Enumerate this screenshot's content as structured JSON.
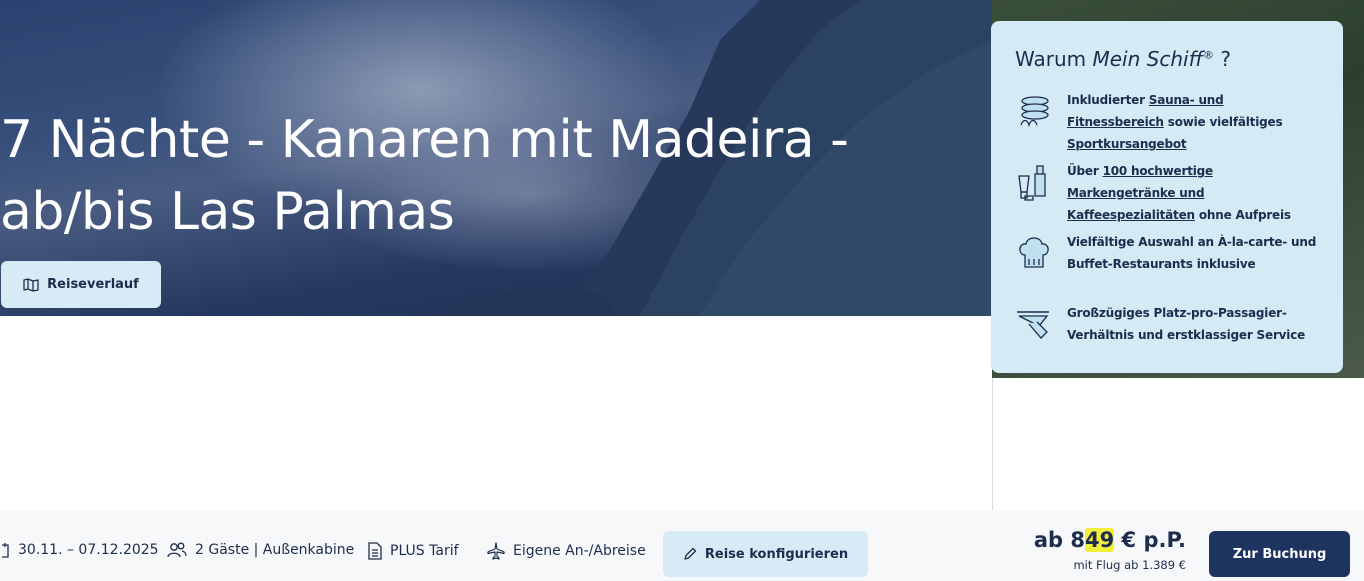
{
  "hero": {
    "title_line1": "7 Nächte - Kanaren mit Madeira -",
    "title_line2": "ab/bis Las Palmas",
    "route_button": "Reiseverlauf"
  },
  "why": {
    "title_prefix": "Warum ",
    "title_brand": "Mein Schiff",
    "title_reg": "®",
    "title_suffix": " ?",
    "features": [
      {
        "icon": "sauna-stones-icon",
        "pre": "Inkludierter ",
        "link1": "Sauna- und Fitnessbereich",
        "mid": " sowie vielfältiges ",
        "link2": "Sportkursangebot",
        "post": ""
      },
      {
        "icon": "drinks-icon",
        "pre": "Über ",
        "link1": "100 hochwertige Markengetränke und Kaffeespezialitäten",
        "mid": " ohne Aufpreis",
        "link2": "",
        "post": ""
      },
      {
        "icon": "chef-hat-icon",
        "pre": "Vielfältige Auswahl an À-la-carte- und Buffet-Restaurants inklusive",
        "link1": "",
        "mid": "",
        "link2": "",
        "post": ""
      },
      {
        "icon": "serving-tray-icon",
        "pre": "Großzügiges Platz-pro-Passagier-Verhältnis und erstklassiger Service",
        "link1": "",
        "mid": "",
        "link2": "",
        "post": ""
      }
    ]
  },
  "booking_bar": {
    "dates": "30.11. – 07.12.2025",
    "guests": "2 Gäste | Außenkabine",
    "tariff": "PLUS Tarif",
    "travel": "Eigene An-/Abreise",
    "configure_button": "Reise konfigurieren",
    "price_prefix": "ab 8",
    "price_highlight": "49",
    "price_suffix": " € p.P.",
    "price_sub": "mit Flug ab 1.389 €",
    "book_button": "Zur Buchung"
  },
  "colors": {
    "navy": "#1e3460",
    "light_blue": "#d6ebf5",
    "card_bg": "#d4eaf4",
    "highlight": "#f3ee3a"
  }
}
